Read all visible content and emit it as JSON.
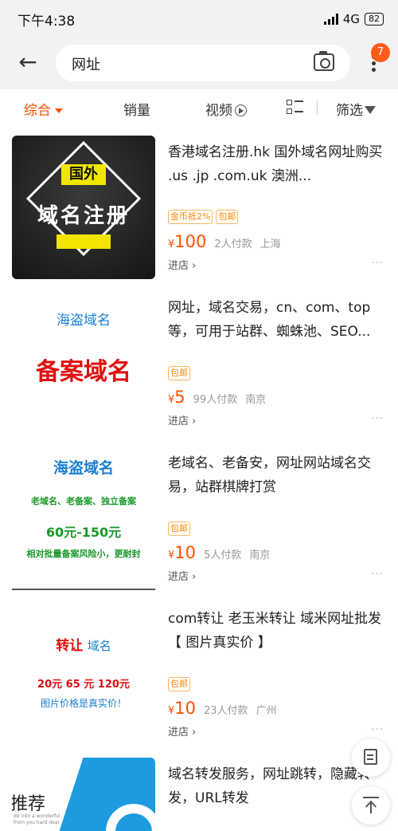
{
  "status": {
    "time": "下午4:38",
    "network": "4G",
    "battery": "82"
  },
  "search": {
    "query": "网址",
    "badge_count": "7"
  },
  "filters": {
    "all": "综合",
    "sales": "销量",
    "video": "视频",
    "filter": "筛选"
  },
  "products": [
    {
      "title": "香港域名注册.hk 国外域名网址购买 .us .jp .com.uk 澳洲...",
      "tags": [
        "金币抵2%",
        "包邮"
      ],
      "currency": "¥",
      "price": "100",
      "sold": "2人付款",
      "location": "上海",
      "shop": "进店 ›",
      "thumb_text": {
        "badge": "国外",
        "main": "域名注册"
      }
    },
    {
      "title": "网址，域名交易，cn、com、top等，可用于站群、蜘蛛池、SEO...",
      "tags": [
        "包邮"
      ],
      "currency": "¥",
      "price": "5",
      "sold": "99人付款",
      "location": "南京",
      "shop": "进店 ›",
      "thumb_text": {
        "line1": "海盗域名",
        "line2": "备案域名"
      }
    },
    {
      "title": "老域名、老备安，网址网站域名交易，站群棋牌打赏",
      "tags": [
        "包邮"
      ],
      "currency": "¥",
      "price": "10",
      "sold": "5人付款",
      "location": "南京",
      "shop": "进店 ›",
      "thumb_text": {
        "line1": "海盗域名",
        "line2": "老域名、老备案、独立备案",
        "line3": "60元-150元",
        "line4": "相对批量备案风险小，更耐封"
      }
    },
    {
      "title": "com转让 老玉米转让 域米网址批发【 图片真实价 】",
      "tags": [
        "包邮"
      ],
      "currency": "¥",
      "price": "10",
      "sold": "23人付款",
      "location": "广州",
      "shop": "进店 ›",
      "thumb_text": {
        "line1a": "转让",
        "line1b": "域名",
        "line2": "20元  65 元 120元",
        "line3": "图片价格是真实价！"
      }
    },
    {
      "title": "域名转发服务，网址跳转，隐藏转发，URL转发",
      "thumb_text": {
        "word": "推荐",
        "small1": "dd into a wonderful",
        "small2": "from you hard deal"
      }
    }
  ],
  "colors": {
    "accent": "#ff4d00",
    "tag": "#ff8a00",
    "badge": "#ff5a1a"
  },
  "icons": [
    "back-arrow-icon",
    "camera-icon",
    "more-icon",
    "play-icon",
    "grid-list-icon",
    "funnel-icon",
    "edit-icon",
    "back-to-top-icon"
  ]
}
